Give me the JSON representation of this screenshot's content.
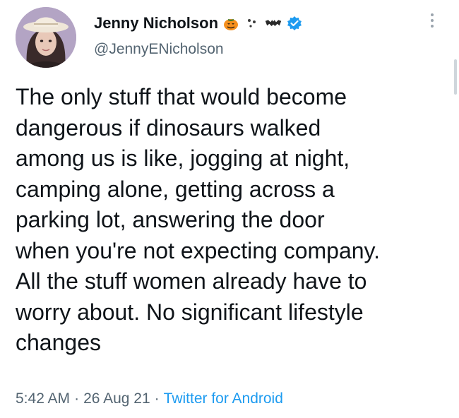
{
  "author": {
    "display_name": "Jenny Nicholson",
    "handle": "@JennyENicholson",
    "name_emojis": [
      "pumpkin-emoji",
      "ghost-emoji",
      "bat-emoji",
      "verified-badge-icon"
    ],
    "verified_color": "#1d9bf0"
  },
  "tweet": {
    "lines": [
      "The only stuff that would become",
      "dangerous if dinosaurs walked",
      "among us is like, jogging at night,",
      "camping alone, getting across a",
      "parking lot, answering the door",
      "when you're not expecting company.",
      "All the stuff women already have to",
      "worry about. No significant lifestyle",
      "changes"
    ]
  },
  "meta": {
    "time": "5:42 AM",
    "date": "26 Aug 21",
    "separator": "·",
    "source": "Twitter for Android"
  },
  "colors": {
    "text": "#0f1419",
    "secondary": "#536471",
    "link": "#1d9bf0"
  }
}
